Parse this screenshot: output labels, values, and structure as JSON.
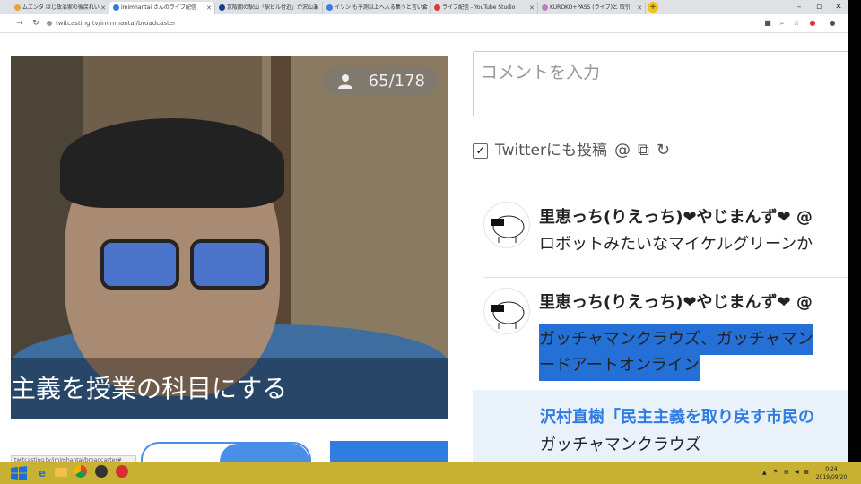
{
  "tabs": [
    {
      "label": "ムエンタ はじ政治家の後戻れい",
      "color": "#e8a33c",
      "active": false
    },
    {
      "label": "imimhantai さんのライブ配信",
      "color": "#2f7de1",
      "active": true
    },
    {
      "label": "京阪間の駅山「駅ビル付近」が沢山あ",
      "color": "#1a3e8a",
      "active": false
    },
    {
      "label": "イソン も予測以上へ入る集うと言い合",
      "color": "#3a7de1",
      "active": false
    },
    {
      "label": "ライブ配信 - YouTube Studio",
      "color": "#e03b30",
      "active": false
    },
    {
      "label": "KUROKO+PASS (ライブ)と 取引",
      "color": "#c07fc0",
      "active": false
    }
  ],
  "address": {
    "url": "twitcasting.tv/imimhantai/broadcaster"
  },
  "video": {
    "viewers": "65/178",
    "subtitle": "主義を授業の科目にする"
  },
  "comment_input": {
    "placeholder": "コメントを入力"
  },
  "twitter": {
    "label": "Twitterにも投稿",
    "checked": true
  },
  "comments": [
    {
      "name": "里恵っち(りえっち)❤やじまんず❤ @",
      "text": "ロボットみたいなマイケルグリーンか",
      "selected": false
    },
    {
      "name": "里恵っち(りえっち)❤やじまんず❤ @",
      "text_line1": "ガッチャマンクラウズ、ガッチャマン",
      "text_line2": "ードアートオンライン",
      "selected": true
    },
    {
      "name": "沢村直樹「民主主義を取り戻す市民の",
      "text": "ガッチャマンクラウズ",
      "highlighted": true
    }
  ],
  "statusbar": {
    "text": "twitcasting.tv/imimhantai/broadcaster#"
  },
  "clock": {
    "time": "0:24",
    "date": "2019/09/20"
  }
}
